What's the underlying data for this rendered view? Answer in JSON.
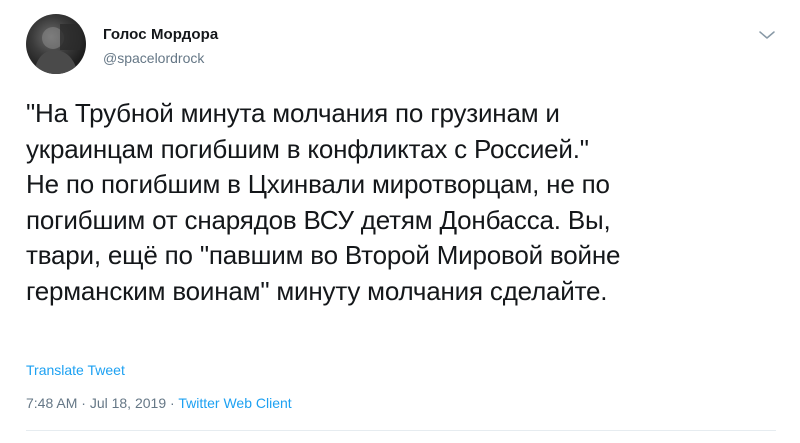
{
  "tweet": {
    "author": {
      "name": "Голос Мордора",
      "handle": "@spacelordrock",
      "avatar_icon": "user-avatar"
    },
    "menu_icon": "chevron-down-icon",
    "text": "\"На Трубной минута молчания по грузинам и\nукраинцам погибшим в конфликтах с Россией.\"\nНе по погибшим в Цхинвали миротворцам, не по\nпогибшим от снарядов ВСУ детям Донбасса. Вы,\nтвари, ещё по \"павшим во Второй Мировой войне\nгерманским воинам\" минуту молчания сделайте.",
    "translate_label": "Translate Tweet",
    "time": "7:48 AM",
    "date": "Jul 18, 2019",
    "separator": "·",
    "source": "Twitter Web Client"
  },
  "colors": {
    "text": "#14171a",
    "secondary": "#657786",
    "link": "#1da1f2",
    "divider": "#e6ecf0"
  }
}
